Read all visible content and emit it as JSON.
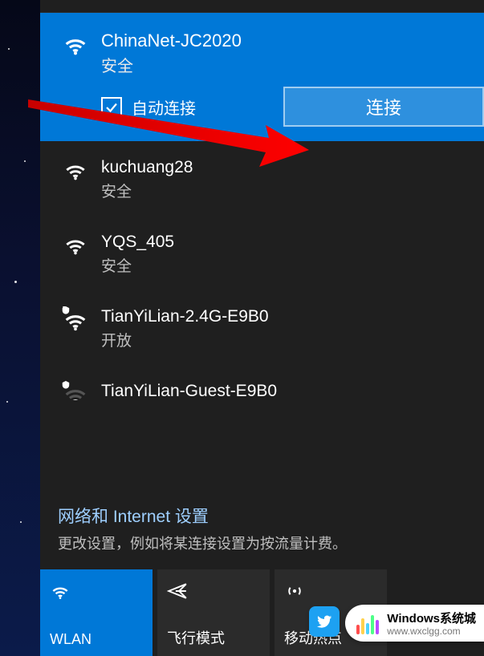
{
  "selected": {
    "name": "ChinaNet-JC2020",
    "security": "安全",
    "auto_connect_label": "自动连接",
    "auto_connect_checked": true,
    "connect_button": "连接"
  },
  "networks": [
    {
      "name": "kuchuang28",
      "security": "安全",
      "signal": 3,
      "open_shield": false
    },
    {
      "name": "YQS_405",
      "security": "安全",
      "signal": 3,
      "open_shield": false
    },
    {
      "name": "TianYiLian-2.4G-E9B0",
      "security": "开放",
      "signal": 3,
      "open_shield": true
    },
    {
      "name": "TianYiLian-Guest-E9B0",
      "security": "",
      "signal": 1,
      "open_shield": true
    }
  ],
  "settings": {
    "title": "网络和 Internet 设置",
    "subtitle": "更改设置，例如将某连接设置为按流量计费。"
  },
  "tiles": {
    "wlan": "WLAN",
    "airplane": "飞行模式",
    "hotspot": "移动热点"
  },
  "watermark": {
    "title": "Windows系统城",
    "url": "www.wxclgg.com"
  }
}
